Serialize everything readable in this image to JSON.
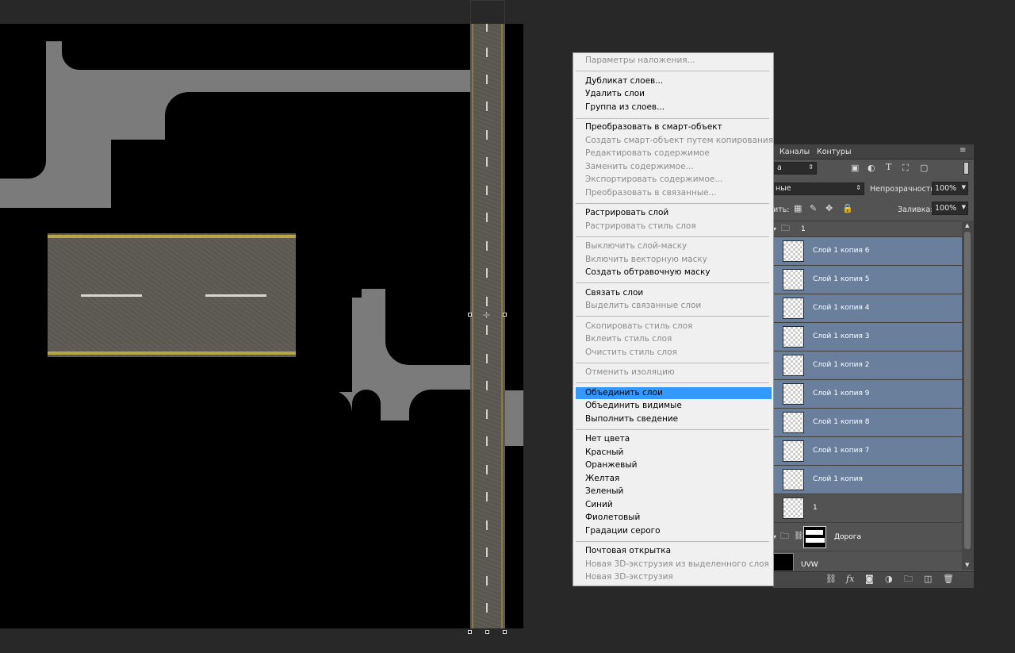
{
  "context_menu": {
    "items": [
      {
        "label": "Параметры наложения...",
        "enabled": false
      },
      {
        "label": "Дубликат слоев...",
        "enabled": true
      },
      {
        "label": "Удалить слои",
        "enabled": true
      },
      {
        "label": "Группа из слоев...",
        "enabled": true
      },
      {
        "label": "Преобразовать в смарт-объект",
        "enabled": true
      },
      {
        "label": "Создать смарт-объект путем копирования",
        "enabled": false
      },
      {
        "label": "Редактировать содержимое",
        "enabled": false
      },
      {
        "label": "Заменить содержимое...",
        "enabled": false
      },
      {
        "label": "Экспортировать содержимое...",
        "enabled": false
      },
      {
        "label": "Преобразовать в связанные...",
        "enabled": false
      },
      {
        "label": "Растрировать слой",
        "enabled": true
      },
      {
        "label": "Растрировать стиль слоя",
        "enabled": false
      },
      {
        "label": "Выключить слой-маску",
        "enabled": false
      },
      {
        "label": "Включить векторную маску",
        "enabled": false
      },
      {
        "label": "Создать обтравочную маску",
        "enabled": true
      },
      {
        "label": "Связать слои",
        "enabled": true
      },
      {
        "label": "Выделить связанные слои",
        "enabled": false
      },
      {
        "label": "Скопировать стиль слоя",
        "enabled": false
      },
      {
        "label": "Вклеить стиль слоя",
        "enabled": false
      },
      {
        "label": "Очистить стиль слоя",
        "enabled": false
      },
      {
        "label": "Отменить изоляцию",
        "enabled": false
      },
      {
        "label": "Объединить слои",
        "enabled": true,
        "highlighted": true
      },
      {
        "label": "Объединить видимые",
        "enabled": true
      },
      {
        "label": "Выполнить сведение",
        "enabled": true
      },
      {
        "label": "Нет цвета",
        "enabled": true
      },
      {
        "label": "Красный",
        "enabled": true
      },
      {
        "label": "Оранжевый",
        "enabled": true
      },
      {
        "label": "Желтая",
        "enabled": true
      },
      {
        "label": "Зеленый",
        "enabled": true
      },
      {
        "label": "Синий",
        "enabled": true
      },
      {
        "label": "Фиолетовый",
        "enabled": true
      },
      {
        "label": "Градации серого",
        "enabled": true
      },
      {
        "label": "Почтовая открытка",
        "enabled": true
      },
      {
        "label": "Новая 3D-экструзия из выделенного слоя",
        "enabled": false
      },
      {
        "label": "Новая 3D-экструзия",
        "enabled": false
      }
    ]
  },
  "layers_panel": {
    "tabs": [
      "Каналы",
      "Контуры"
    ],
    "filter_value": "а",
    "blend_mode": "ные",
    "opacity_label": "Непрозрачность:",
    "opacity_value": "100%",
    "lock_label": "ить:",
    "fill_label": "Заливка:",
    "fill_value": "100%",
    "group_name": "1",
    "layers": [
      {
        "name": "Слой 1 копия 6",
        "selected": true
      },
      {
        "name": "Слой 1 копия 5",
        "selected": true
      },
      {
        "name": "Слой 1 копия 4",
        "selected": true
      },
      {
        "name": "Слой 1 копия 3",
        "selected": true
      },
      {
        "name": "Слой 1 копия 2",
        "selected": true
      },
      {
        "name": "Слой 1 копия 9",
        "selected": true
      },
      {
        "name": "Слой 1 копия 8",
        "selected": true
      },
      {
        "name": "Слой 1 копия 7",
        "selected": true
      },
      {
        "name": "Слой 1 копия",
        "selected": true
      },
      {
        "name": "1",
        "selected": false
      }
    ],
    "group2_name": "Дорога",
    "uvw_name": "UVW",
    "icons": [
      "link-icon",
      "fx-icon",
      "mask-icon",
      "adjustment-icon",
      "folder-icon",
      "new-layer-icon",
      "trash-icon"
    ]
  }
}
